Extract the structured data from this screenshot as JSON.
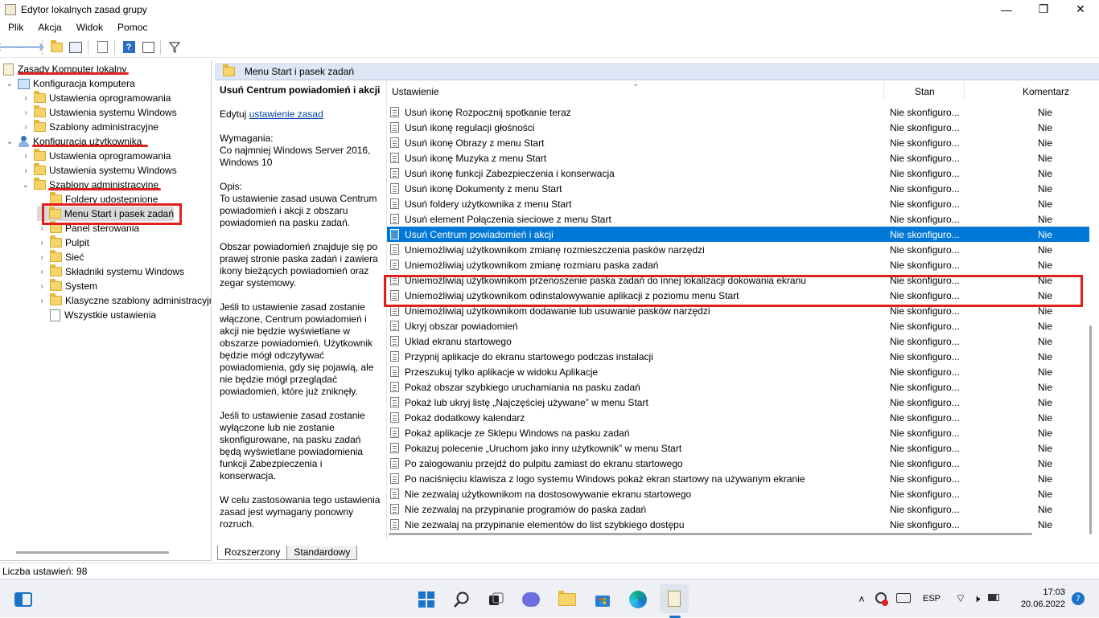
{
  "window": {
    "title": "Edytor lokalnych zasad grupy",
    "minimize": "—",
    "maximize": "❐",
    "close": "✕"
  },
  "menu": [
    "Plik",
    "Akcja",
    "Widok",
    "Pomoc"
  ],
  "toolbar": [
    "back-icon",
    "forward-icon",
    "up-folder-icon",
    "show-hide-tree-icon",
    "export-list-icon",
    "help-icon",
    "properties-icon",
    "filter-icon"
  ],
  "tree": {
    "root": "Zasady Komputer lokalny",
    "computer": "Konfiguracja komputera",
    "computer_children": [
      "Ustawienia oprogramowania",
      "Ustawienia systemu Windows",
      "Szablony administracyjne"
    ],
    "user": "Konfiguracja użytkownika",
    "user_children": [
      "Ustawienia oprogramowania",
      "Ustawienia systemu Windows",
      "Szablony administracyjne"
    ],
    "admin_children": [
      "Foldery udostępnione",
      "Menu Start i pasek zadań",
      "Panel sterowania",
      "Pulpit",
      "Sieć",
      "Składniki systemu Windows",
      "System",
      "Klasyczne szablony administracyjne",
      "Wszystkie ustawienia"
    ]
  },
  "panel": {
    "header": "Menu Start i pasek zadań",
    "desc_title": "Usuń Centrum powiadomień i akcji",
    "edit_prefix": "Edytuj ",
    "edit_link": "ustawienie zasad ",
    "req_label": "Wymagania:",
    "req_text": "Co najmniej Windows Server 2016, Windows 10",
    "opis_label": "Opis:",
    "p1": "To ustawienie zasad usuwa Centrum powiadomień i akcji z obszaru powiadomień na pasku zadań.",
    "p2": "Obszar powiadomień znajduje się po prawej stronie paska zadań i zawiera ikony bieżących powiadomień oraz zegar systemowy.",
    "p3": "Jeśli to ustawienie zasad zostanie włączone, Centrum powiadomień i akcji nie będzie wyświetlane w obszarze powiadomień. Użytkownik będzie mógł odczytywać powiadomienia, gdy się pojawią, ale nie będzie mógł przeglądać powiadomień, które już zniknęły.",
    "p4": "Jeśli to ustawienie zasad zostanie wyłączone lub nie zostanie skonfigurowane, na pasku zadań będą wyświetlane powiadomienia funkcji Zabezpieczenia i konserwacja.",
    "p5": "W celu zastosowania tego ustawienia zasad jest wymagany ponowny rozruch."
  },
  "columns": {
    "setting": "Ustawienie",
    "state": "Stan",
    "comment": "Komentarz"
  },
  "rows": [
    {
      "setting": "Usuń ikonę Rozpocznij spotkanie teraz",
      "state": "Nie skonfiguro...",
      "comment": "Nie"
    },
    {
      "setting": "Usuń ikonę regulacji głośności",
      "state": "Nie skonfiguro...",
      "comment": "Nie"
    },
    {
      "setting": "Usuń ikonę Obrazy z menu Start",
      "state": "Nie skonfiguro...",
      "comment": "Nie"
    },
    {
      "setting": "Usuń ikonę Muzyka z menu Start",
      "state": "Nie skonfiguro...",
      "comment": "Nie"
    },
    {
      "setting": "Usuń ikonę funkcji Zabezpieczenia i konserwacja",
      "state": "Nie skonfiguro...",
      "comment": "Nie"
    },
    {
      "setting": "Usuń ikonę Dokumenty z menu Start",
      "state": "Nie skonfiguro...",
      "comment": "Nie"
    },
    {
      "setting": "Usuń foldery użytkownika z menu Start",
      "state": "Nie skonfiguro...",
      "comment": "Nie"
    },
    {
      "setting": "Usuń element Połączenia sieciowe z menu Start",
      "state": "Nie skonfiguro...",
      "comment": "Nie"
    },
    {
      "setting": "Usuń Centrum powiadomień i akcji",
      "state": "Nie skonfiguro...",
      "comment": "Nie"
    },
    {
      "setting": "Uniemożliwiaj użytkownikom zmianę rozmieszczenia pasków narzędzi",
      "state": "Nie skonfiguro...",
      "comment": "Nie"
    },
    {
      "setting": "Uniemożliwiaj użytkownikom zmianę rozmiaru paska zadań",
      "state": "Nie skonfiguro...",
      "comment": "Nie"
    },
    {
      "setting": "Uniemożliwiaj użytkownikom przenoszenie paska zadań do innej lokalizacji dokowania ekranu",
      "state": "Nie skonfiguro...",
      "comment": "Nie"
    },
    {
      "setting": "Uniemożliwiaj użytkownikom odinstalowywanie aplikacji z poziomu menu Start",
      "state": "Nie skonfiguro...",
      "comment": "Nie"
    },
    {
      "setting": "Uniemożliwiaj użytkownikom dodawanie lub usuwanie pasków narzędzi",
      "state": "Nie skonfiguro...",
      "comment": "Nie"
    },
    {
      "setting": "Ukryj obszar powiadomień",
      "state": "Nie skonfiguro...",
      "comment": "Nie"
    },
    {
      "setting": "Układ ekranu startowego",
      "state": "Nie skonfiguro...",
      "comment": "Nie"
    },
    {
      "setting": "Przypnij aplikacje do ekranu startowego podczas instalacji",
      "state": "Nie skonfiguro...",
      "comment": "Nie"
    },
    {
      "setting": "Przeszukuj tylko aplikacje w widoku Aplikacje",
      "state": "Nie skonfiguro...",
      "comment": "Nie"
    },
    {
      "setting": "Pokaż obszar szybkiego uruchamiania na pasku zadań",
      "state": "Nie skonfiguro...",
      "comment": "Nie"
    },
    {
      "setting": "Pokaż lub ukryj listę „Najczęściej używane” w menu Start",
      "state": "Nie skonfiguro...",
      "comment": "Nie"
    },
    {
      "setting": "Pokaż dodatkowy kalendarz",
      "state": "Nie skonfiguro...",
      "comment": "Nie"
    },
    {
      "setting": "Pokaż aplikacje ze Sklepu Windows na pasku zadań",
      "state": "Nie skonfiguro...",
      "comment": "Nie"
    },
    {
      "setting": "Pokazuj polecenie „Uruchom jako inny użytkownik” w menu Start",
      "state": "Nie skonfiguro...",
      "comment": "Nie"
    },
    {
      "setting": "Po zalogowaniu przejdź do pulpitu zamiast do ekranu startowego",
      "state": "Nie skonfiguro...",
      "comment": "Nie"
    },
    {
      "setting": "Po naciśnięciu klawisza z logo systemu Windows pokaż ekran startowy na używanym ekranie",
      "state": "Nie skonfiguro...",
      "comment": "Nie"
    },
    {
      "setting": "Nie zezwalaj użytkownikom na dostosowywanie ekranu startowego",
      "state": "Nie skonfiguro...",
      "comment": "Nie"
    },
    {
      "setting": "Nie zezwalaj na przypinanie programów do paska zadań",
      "state": "Nie skonfiguro...",
      "comment": "Nie"
    },
    {
      "setting": "Nie zezwalaj na przypinanie elementów do list szybkiego dostępu",
      "state": "Nie skonfiguro...",
      "comment": "Nie"
    }
  ],
  "tabs": [
    "Rozszerzony",
    "Standardowy"
  ],
  "status": "Liczba ustawień: 98",
  "taskbar": {
    "lang": "ESP",
    "time": "17:03",
    "date": "20.06.2022",
    "notifications": "7",
    "apps": [
      "windows-start-icon",
      "search-icon",
      "task-view-icon",
      "teams-chat-icon",
      "file-explorer-icon",
      "store-icon",
      "edge-icon",
      "group-policy-editor-icon"
    ],
    "tray": [
      "chevron-up-icon",
      "app-tray-icon",
      "keyboard-icon",
      "wifi-icon",
      "volume-muted-icon",
      "battery-icon"
    ]
  },
  "colors": {
    "selection": "#0078d7",
    "annotation": "#e0201e",
    "header": "#dce6f4"
  }
}
